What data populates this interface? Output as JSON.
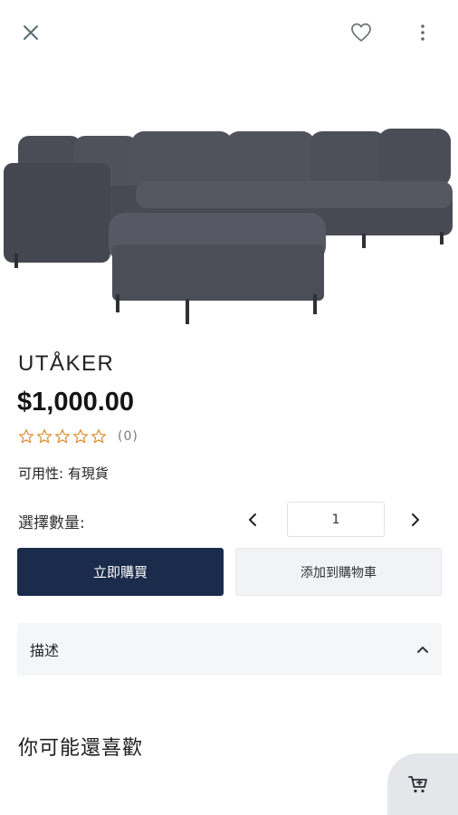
{
  "header": {
    "close_icon": "close-icon",
    "favorite_icon": "heart-icon",
    "more_icon": "more-vertical-icon"
  },
  "product": {
    "image_alt": "grey-sectional-sofa",
    "name": "UTÅKER",
    "price": "$1,000.00",
    "rating": {
      "stars_filled": 0,
      "stars_total": 5,
      "review_count": "(0)",
      "star_color": "#e08a2c"
    },
    "availability": "可用性: 有現貨"
  },
  "quantity": {
    "label": "選擇數量:",
    "value": "1",
    "prev_icon": "chevron-left-icon",
    "next_icon": "chevron-right-icon"
  },
  "actions": {
    "buy_now": "立即購買",
    "add_to_cart": "添加到購物車",
    "primary_color": "#1a2b4c"
  },
  "description": {
    "label": "描述",
    "icon": "chevron-up-icon"
  },
  "recommendations": {
    "title": "你可能還喜歡"
  },
  "floating_cart": {
    "icon": "cart-plus-icon"
  }
}
